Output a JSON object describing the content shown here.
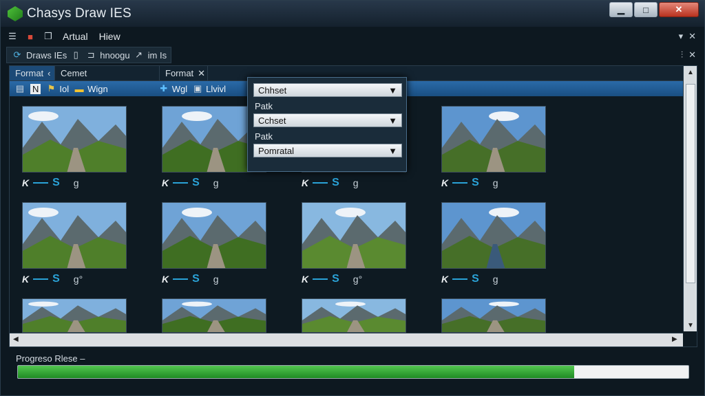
{
  "app": {
    "title": "Chasys Draw IES",
    "logo_color": "#3db53a"
  },
  "window_controls": {
    "minimize": "▁",
    "maximize": "□",
    "close": "✕"
  },
  "menubar": {
    "items": [
      "Artual",
      "Hiew"
    ],
    "icons": [
      "hamburger-icon",
      "palette-icon",
      "layers-icon"
    ],
    "right": [
      "▾",
      "✕"
    ]
  },
  "toolbar": {
    "items": [
      {
        "icon": "refresh-icon",
        "label": "Draws IEs"
      },
      {
        "icon": "document-icon",
        "label": ""
      },
      {
        "icon": "frame-icon",
        "label": "hnoogu"
      },
      {
        "icon": "pen-icon",
        "label": "im Is"
      }
    ],
    "right": [
      "⫶",
      "✕"
    ]
  },
  "tabs": [
    {
      "label": "Format",
      "close": "‹",
      "selected": true
    },
    {
      "label": "Cemet",
      "close": "",
      "selected": false
    },
    {
      "label": "Format",
      "close": "✕",
      "selected": false
    }
  ],
  "ribbon": {
    "items": [
      {
        "icon": "copy-icon",
        "label": ""
      },
      {
        "icon": "letter-icon",
        "label": "N"
      },
      {
        "icon": "flag-icon",
        "label": "Iol"
      },
      {
        "icon": "brush-icon",
        "label": "Wign"
      },
      {
        "icon": "plus-icon",
        "label": "Wgl"
      },
      {
        "icon": "image-icon",
        "label": "Llvivl"
      }
    ]
  },
  "thumbnails": [
    {
      "tag": "K",
      "s": "S",
      "g": "g"
    },
    {
      "tag": "K",
      "s": "S",
      "g": "g"
    },
    {
      "tag": "K",
      "s": "S",
      "g": "g"
    },
    {
      "tag": "K",
      "s": "S",
      "g": "g"
    },
    {
      "tag": "K",
      "s": "S",
      "g": "g°"
    },
    {
      "tag": "K",
      "s": "S",
      "g": "g"
    },
    {
      "tag": "K",
      "s": "S",
      "g": "g°"
    },
    {
      "tag": "K",
      "s": "S",
      "g": "g"
    },
    {
      "tag": "",
      "s": "",
      "g": ""
    },
    {
      "tag": "",
      "s": "",
      "g": ""
    },
    {
      "tag": "",
      "s": "",
      "g": ""
    },
    {
      "tag": "",
      "s": "",
      "g": ""
    }
  ],
  "dropdown": {
    "rows": [
      {
        "type": "select",
        "value": "Chhset"
      },
      {
        "type": "label",
        "value": "Patk"
      },
      {
        "type": "select",
        "value": "Cchset"
      },
      {
        "type": "label",
        "value": "Patk"
      },
      {
        "type": "select",
        "value": "Pomratal"
      }
    ]
  },
  "progress": {
    "label": "Progreso Rlese  –",
    "value": 0.83,
    "color": "#2fa833"
  }
}
